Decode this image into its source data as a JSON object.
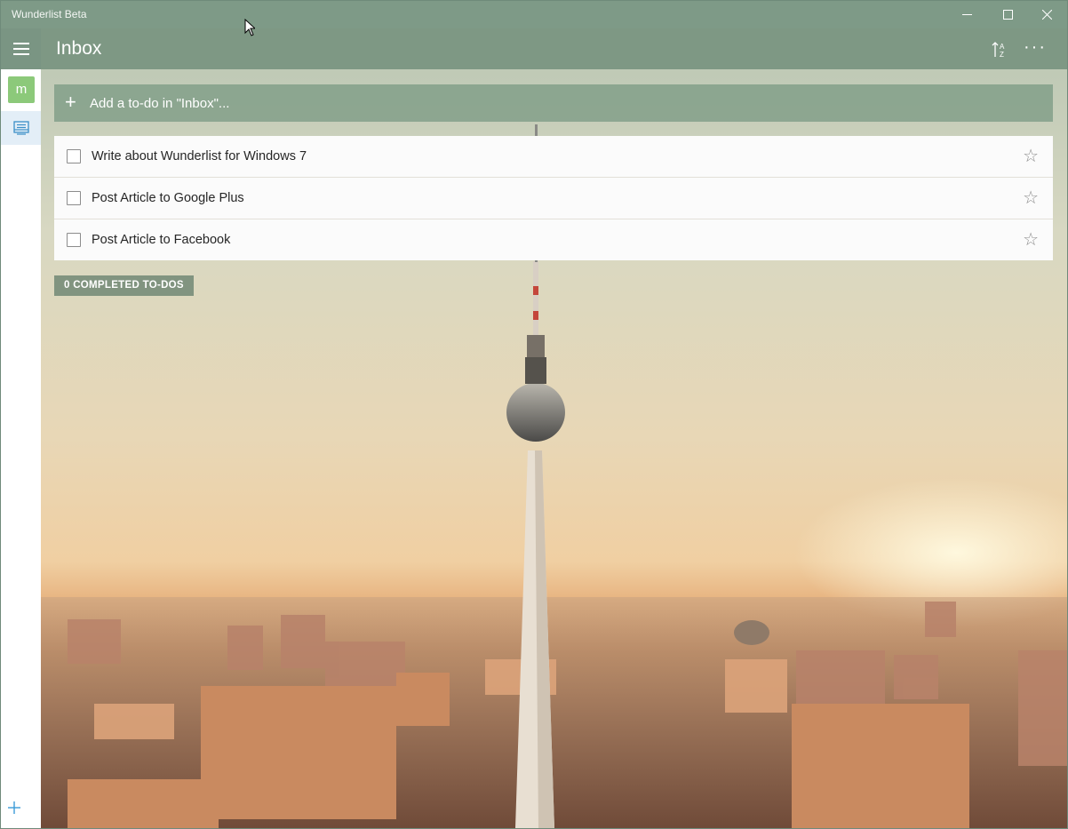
{
  "window": {
    "title": "Wunderlist Beta",
    "controls": {
      "minimize": "—",
      "maximize": "☐",
      "close": "✕"
    }
  },
  "sidebar": {
    "avatar_letter": "m",
    "add_list_icon": "plus-icon",
    "items": [
      {
        "icon": "inbox-icon",
        "selected": true
      }
    ]
  },
  "header": {
    "list_title": "Inbox",
    "sort_icon": "sort-az-icon",
    "more_icon": "ellipsis-icon",
    "more_label": "···"
  },
  "add_todo": {
    "icon": "+",
    "placeholder": "Add a to-do in \"Inbox\"..."
  },
  "tasks": [
    {
      "title": "Write about Wunderlist for Windows 7",
      "completed": false,
      "starred": false
    },
    {
      "title": "Post Article to Google Plus",
      "completed": false,
      "starred": false
    },
    {
      "title": "Post Article to Facebook",
      "completed": false,
      "starred": false
    }
  ],
  "completed_badge": "0 COMPLETED TO-DOS",
  "star_glyph": "☆",
  "colors": {
    "header": "#7a9583",
    "avatar": "#8cc97a",
    "accent": "#3b9bd8",
    "selected_nav": "#e3eef7"
  },
  "background": "Berlin TV tower cityscape at sunset"
}
